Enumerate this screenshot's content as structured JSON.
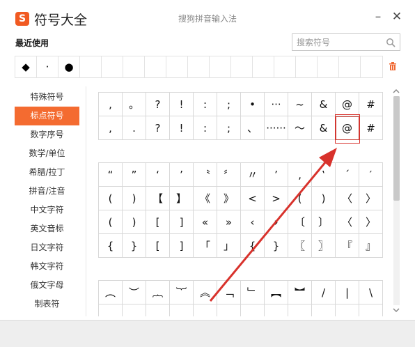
{
  "app": {
    "logo_text": "S",
    "title": "符号大全",
    "window_title": "搜狗拼音输入法",
    "minimize": "–",
    "close": "✕"
  },
  "recent": {
    "label": "最近使用",
    "symbols": [
      "◆",
      "·",
      "●",
      "",
      "",
      "",
      "",
      "",
      "",
      "",
      "",
      "",
      "",
      "",
      "",
      "",
      ""
    ]
  },
  "search": {
    "placeholder": "搜索符号",
    "value": ""
  },
  "sidebar": {
    "items": [
      {
        "label": "特殊符号"
      },
      {
        "label": "标点符号"
      },
      {
        "label": "数字序号"
      },
      {
        "label": "数学/单位"
      },
      {
        "label": "希腊/拉丁"
      },
      {
        "label": "拼音/注音"
      },
      {
        "label": "中文字符"
      },
      {
        "label": "英文音标"
      },
      {
        "label": "日文字符"
      },
      {
        "label": "韩文字符"
      },
      {
        "label": "俄文字母"
      },
      {
        "label": "制表符"
      }
    ],
    "active_index": 1
  },
  "groups": [
    {
      "rows": [
        [
          ",",
          "。",
          "?",
          "!",
          ":",
          ";",
          "•",
          "···",
          "~",
          "&",
          "@",
          "#"
        ],
        [
          ",",
          ".",
          "?",
          "!",
          ":",
          ";",
          "、",
          "······",
          "〜",
          "&",
          "@",
          "#"
        ]
      ]
    },
    {
      "rows": [
        [
          "“",
          "”",
          "‘",
          "’",
          "〝",
          "〞",
          "〃",
          "’",
          "‚",
          "‛",
          "´",
          "′"
        ],
        [
          "(",
          ")",
          "【",
          "】",
          "《",
          "》",
          "<",
          ">",
          "(",
          ")",
          "〈",
          "〉"
        ],
        [
          "(",
          ")",
          "[",
          "]",
          "«",
          "»",
          "‹",
          "›",
          "〔",
          "〕",
          "〈",
          "〉"
        ],
        [
          "{",
          "}",
          "[",
          "]",
          "「",
          "」",
          "{",
          "}",
          "〖",
          "〗",
          "『",
          "』"
        ]
      ]
    },
    {
      "rows": [
        [
          "︵",
          "︶",
          "︷",
          "︸",
          "︽",
          "﹁",
          "﹂",
          "︻",
          "︼",
          "/",
          "|",
          "\\"
        ],
        [
          "",
          "",
          "",
          "",
          "",
          "",
          "",
          "",
          "",
          "",
          "",
          ""
        ]
      ]
    }
  ],
  "highlight": {
    "group": 0,
    "row": 1,
    "col": 10
  },
  "colors": {
    "accent": "#f46b30",
    "annotation": "#d8322c"
  }
}
